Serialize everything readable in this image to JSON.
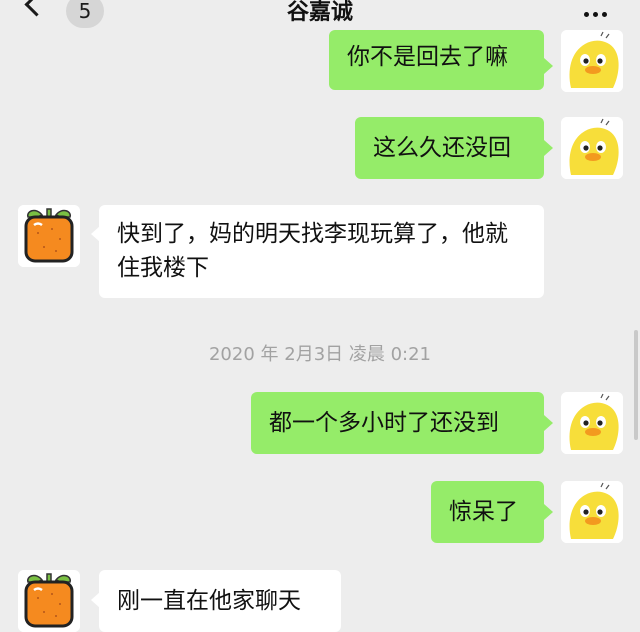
{
  "header": {
    "title": "谷嘉诚",
    "unread_count": "5"
  },
  "messages": [
    {
      "sender": "me",
      "text": "你不是回去了嘛",
      "avatar": "duck-icon"
    },
    {
      "sender": "me",
      "text": "这么久还没回",
      "avatar": "duck-icon"
    },
    {
      "sender": "them",
      "text": "快到了，妈的明天找李现玩算了，他就住我楼下",
      "avatar": "orange-icon"
    },
    {
      "sender": "me",
      "text": "都一个多小时了还没到",
      "avatar": "duck-icon"
    },
    {
      "sender": "me",
      "text": "惊呆了",
      "avatar": "duck-icon"
    },
    {
      "sender": "them",
      "text": "刚一直在他家聊天",
      "avatar": "orange-icon"
    }
  ],
  "timestamp": "2020 年 2月3日 凌晨 0:21",
  "colors": {
    "background": "#ededed",
    "my_bubble": "#95ec69",
    "their_bubble": "#ffffff"
  }
}
